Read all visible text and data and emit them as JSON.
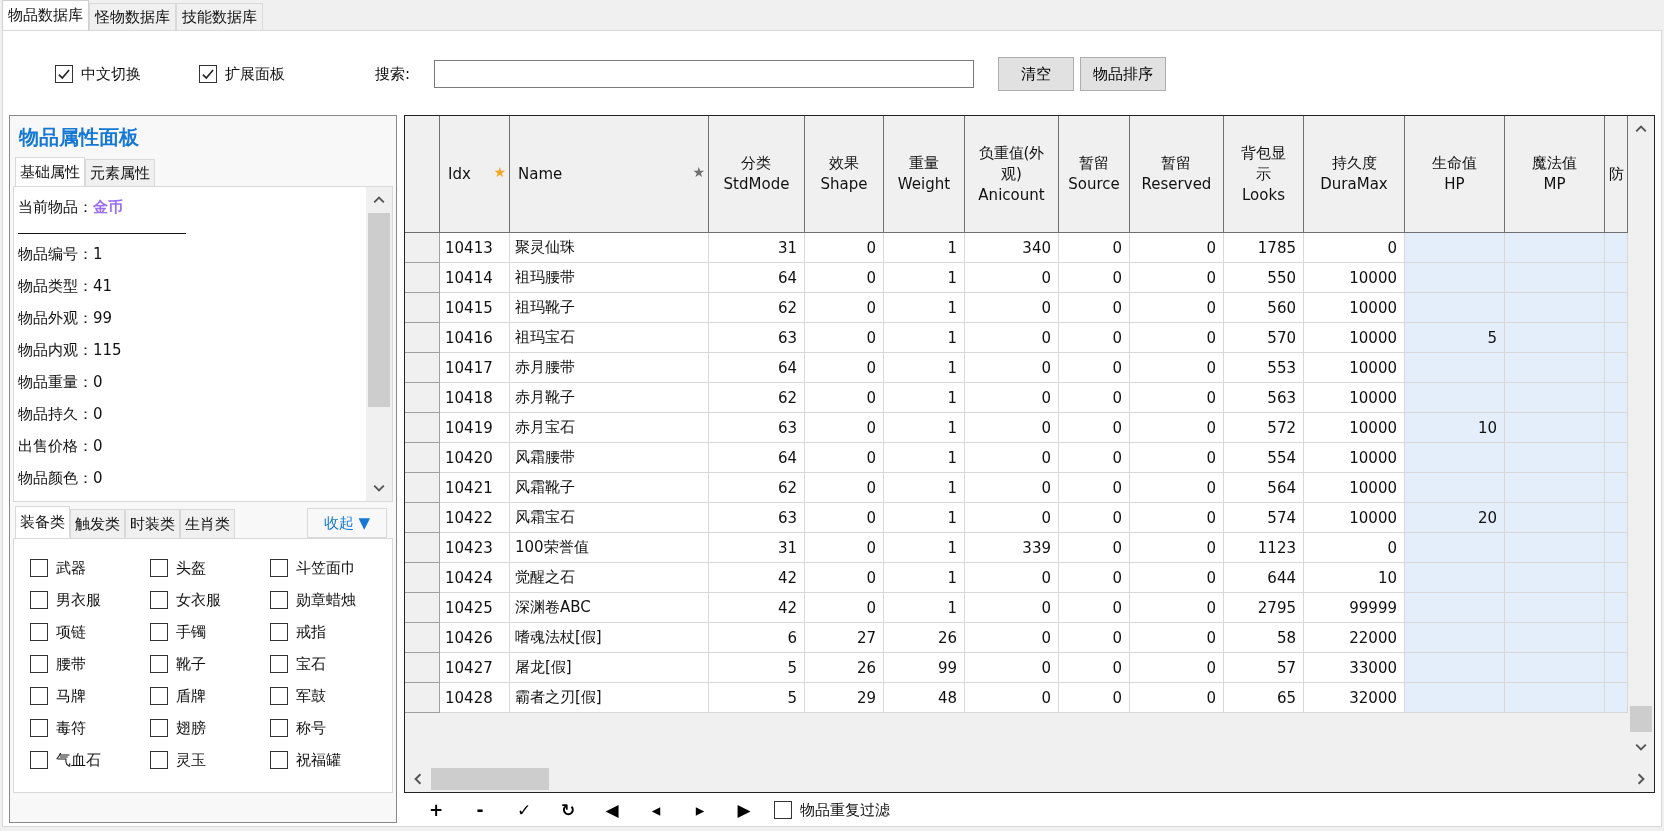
{
  "tabs": [
    {
      "label": "物品数据库",
      "selected": true
    },
    {
      "label": "怪物数据库",
      "selected": false
    },
    {
      "label": "技能数据库",
      "selected": false
    }
  ],
  "options": [
    {
      "label": "中文切换",
      "checked": true
    },
    {
      "label": "扩展面板",
      "checked": true
    }
  ],
  "search": {
    "label": "搜索:"
  },
  "buttons": [
    "清空",
    "物品排序"
  ],
  "properties_panel": {
    "title": "物品属性面板",
    "tabs": [
      {
        "label": "基础属性",
        "selected": true
      },
      {
        "label": "元素属性",
        "selected": false
      }
    ],
    "current_item": {
      "label": "当前物品：",
      "value": "金币"
    },
    "fields": [
      {
        "label": "物品编号：",
        "value": "1"
      },
      {
        "label": "物品类型：",
        "value": "41"
      },
      {
        "label": "物品外观：",
        "value": "99"
      },
      {
        "label": "物品内观：",
        "value": "115"
      },
      {
        "label": "物品重量：",
        "value": "0"
      },
      {
        "label": "物品持久：",
        "value": "0"
      },
      {
        "label": "出售价格：",
        "value": "0"
      },
      {
        "label": "物品颜色：",
        "value": "0"
      }
    ]
  },
  "category_tabs": [
    {
      "label": "装备类",
      "selected": true
    },
    {
      "label": "触发类",
      "selected": false
    },
    {
      "label": "时装类",
      "selected": false
    },
    {
      "label": "生肖类",
      "selected": false
    }
  ],
  "collapse_button": "收起 ▼",
  "categories": [
    {
      "label": "武器",
      "checked": false
    },
    {
      "label": "头盔",
      "checked": false
    },
    {
      "label": "斗笠面巾",
      "checked": false
    },
    {
      "label": "男衣服",
      "checked": false
    },
    {
      "label": "女衣服",
      "checked": false
    },
    {
      "label": "勋章蜡烛",
      "checked": false
    },
    {
      "label": "项链",
      "checked": false
    },
    {
      "label": "手镯",
      "checked": false
    },
    {
      "label": "戒指",
      "checked": false
    },
    {
      "label": "腰带",
      "checked": false
    },
    {
      "label": "靴子",
      "checked": false
    },
    {
      "label": "宝石",
      "checked": false
    },
    {
      "label": "马牌",
      "checked": false
    },
    {
      "label": "盾牌",
      "checked": false
    },
    {
      "label": "军鼓",
      "checked": false
    },
    {
      "label": "毒符",
      "checked": false
    },
    {
      "label": "翅膀",
      "checked": false
    },
    {
      "label": "称号",
      "checked": false
    },
    {
      "label": "气血石",
      "checked": false
    },
    {
      "label": "灵玉",
      "checked": false
    },
    {
      "label": "祝福罐",
      "checked": false
    }
  ],
  "table": {
    "columns": [
      {
        "label": "Idx",
        "marker": {
          "text": "★",
          "color": "#f5a623"
        }
      },
      {
        "label": "Name",
        "marker": {
          "text": "★",
          "color": "#707070"
        }
      },
      {
        "label": "分类\nStdMode"
      },
      {
        "label": "效果\nShape"
      },
      {
        "label": "重量\nWeight"
      },
      {
        "label": "负重值(外观)\nAnicount"
      },
      {
        "label": "暂留\nSource"
      },
      {
        "label": "暂留\nReserved"
      },
      {
        "label": "背包显示\nLooks"
      },
      {
        "label": "持久度\nDuraMax"
      },
      {
        "label": "生命值\nHP",
        "highlighted": true
      },
      {
        "label": "魔法值\nMP",
        "highlighted": true
      },
      {
        "label": "防",
        "highlighted": true
      }
    ],
    "rows": [
      [
        "10413",
        "聚灵仙珠",
        "31",
        "0",
        "1",
        "340",
        "0",
        "0",
        "1785",
        "0",
        null,
        null,
        null
      ],
      [
        "10414",
        "祖玛腰带",
        "64",
        "0",
        "1",
        "0",
        "0",
        "0",
        "550",
        "10000",
        null,
        null,
        null
      ],
      [
        "10415",
        "祖玛靴子",
        "62",
        "0",
        "1",
        "0",
        "0",
        "0",
        "560",
        "10000",
        null,
        null,
        null
      ],
      [
        "10416",
        "祖玛宝石",
        "63",
        "0",
        "1",
        "0",
        "0",
        "0",
        "570",
        "10000",
        "5",
        null,
        null
      ],
      [
        "10417",
        "赤月腰带",
        "64",
        "0",
        "1",
        "0",
        "0",
        "0",
        "553",
        "10000",
        null,
        null,
        null
      ],
      [
        "10418",
        "赤月靴子",
        "62",
        "0",
        "1",
        "0",
        "0",
        "0",
        "563",
        "10000",
        null,
        null,
        null
      ],
      [
        "10419",
        "赤月宝石",
        "63",
        "0",
        "1",
        "0",
        "0",
        "0",
        "572",
        "10000",
        "10",
        null,
        null
      ],
      [
        "10420",
        "风霜腰带",
        "64",
        "0",
        "1",
        "0",
        "0",
        "0",
        "554",
        "10000",
        null,
        null,
        null
      ],
      [
        "10421",
        "风霜靴子",
        "62",
        "0",
        "1",
        "0",
        "0",
        "0",
        "564",
        "10000",
        null,
        null,
        null
      ],
      [
        "10422",
        "风霜宝石",
        "63",
        "0",
        "1",
        "0",
        "0",
        "0",
        "574",
        "10000",
        "20",
        null,
        null
      ],
      [
        "10423",
        "100荣誉值",
        "31",
        "0",
        "1",
        "339",
        "0",
        "0",
        "1123",
        "0",
        null,
        null,
        null
      ],
      [
        "10424",
        "觉醒之石",
        "42",
        "0",
        "1",
        "0",
        "0",
        "0",
        "644",
        "10",
        null,
        null,
        null
      ],
      [
        "10425",
        "深渊卷ABC",
        "42",
        "0",
        "1",
        "0",
        "0",
        "0",
        "2795",
        "99999",
        null,
        null,
        null
      ],
      [
        "10426",
        "嗜魂法杖[假]",
        "6",
        "27",
        "26",
        "0",
        "0",
        "0",
        "58",
        "22000",
        null,
        null,
        null
      ],
      [
        "10427",
        "屠龙[假]",
        "5",
        "26",
        "99",
        "0",
        "0",
        "0",
        "57",
        "33000",
        null,
        null,
        null
      ],
      [
        "10428",
        "霸者之刃[假]",
        "5",
        "29",
        "48",
        "0",
        "0",
        "0",
        "65",
        "32000",
        null,
        null,
        null
      ]
    ]
  },
  "toolbar": [
    "+",
    "-",
    "✓",
    "↻",
    "◀",
    "◂",
    "▸",
    "▶"
  ],
  "filter": {
    "label": "物品重复过滤",
    "checked": false
  }
}
